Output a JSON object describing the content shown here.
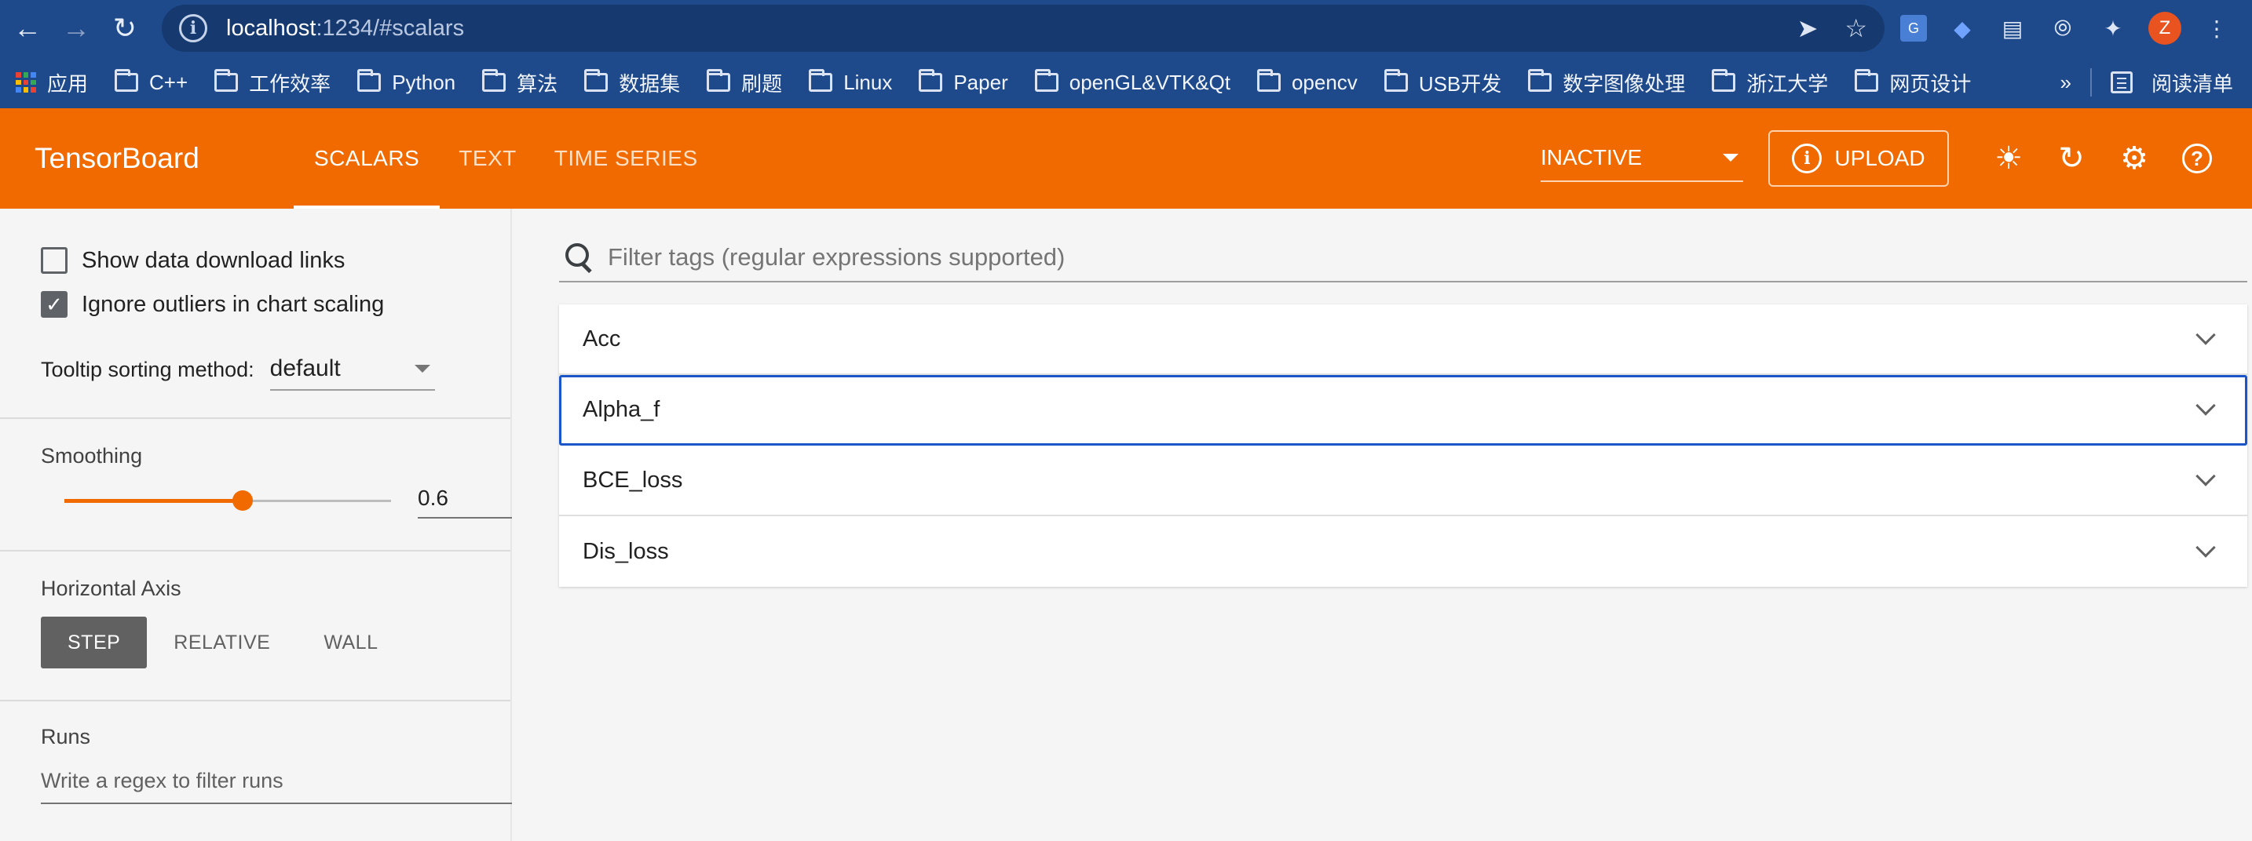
{
  "browser": {
    "url_host": "localhost",
    "url_rest": ":1234/#scalars",
    "avatar_letter": "Z",
    "bookmarks": [
      {
        "label": "应用",
        "icon": "apps-grid-icon"
      },
      {
        "label": "C++",
        "icon": "folder-icon"
      },
      {
        "label": "工作效率",
        "icon": "folder-icon"
      },
      {
        "label": "Python",
        "icon": "folder-icon"
      },
      {
        "label": "算法",
        "icon": "folder-icon"
      },
      {
        "label": "数据集",
        "icon": "folder-icon"
      },
      {
        "label": "刷题",
        "icon": "folder-icon"
      },
      {
        "label": "Linux",
        "icon": "folder-icon"
      },
      {
        "label": "Paper",
        "icon": "folder-icon"
      },
      {
        "label": "openGL&VTK&Qt",
        "icon": "folder-icon"
      },
      {
        "label": "opencv",
        "icon": "folder-icon"
      },
      {
        "label": "USB开发",
        "icon": "folder-icon"
      },
      {
        "label": "数字图像处理",
        "icon": "folder-icon"
      },
      {
        "label": "浙江大学",
        "icon": "folder-icon"
      },
      {
        "label": "网页设计",
        "icon": "folder-icon"
      }
    ],
    "more_label": "»",
    "reading_list": "阅读清单"
  },
  "header": {
    "brand": "TensorBoard",
    "tabs": [
      "SCALARS",
      "TEXT",
      "TIME SERIES"
    ],
    "active_tab": 0,
    "status_select": "INACTIVE",
    "upload_label": "UPLOAD",
    "accent": "#f06a00"
  },
  "sidebar": {
    "show_download_links": {
      "label": "Show data download links",
      "checked": false
    },
    "ignore_outliers": {
      "label": "Ignore outliers in chart scaling",
      "checked": true
    },
    "tooltip_sorting_label": "Tooltip sorting method:",
    "tooltip_sorting_value": "default",
    "smoothing_title": "Smoothing",
    "smoothing_value": "0.6",
    "smoothing_fraction": 0.6,
    "horizontal_axis_title": "Horizontal Axis",
    "axis_options": [
      "STEP",
      "RELATIVE",
      "WALL"
    ],
    "axis_selected": 0,
    "runs_title": "Runs",
    "runs_placeholder": "Write a regex to filter runs"
  },
  "main": {
    "filter_placeholder": "Filter tags (regular expressions supported)",
    "tags": [
      "Acc",
      "Alpha_f",
      "BCE_loss",
      "Dis_loss"
    ],
    "focused_tag": 1
  }
}
